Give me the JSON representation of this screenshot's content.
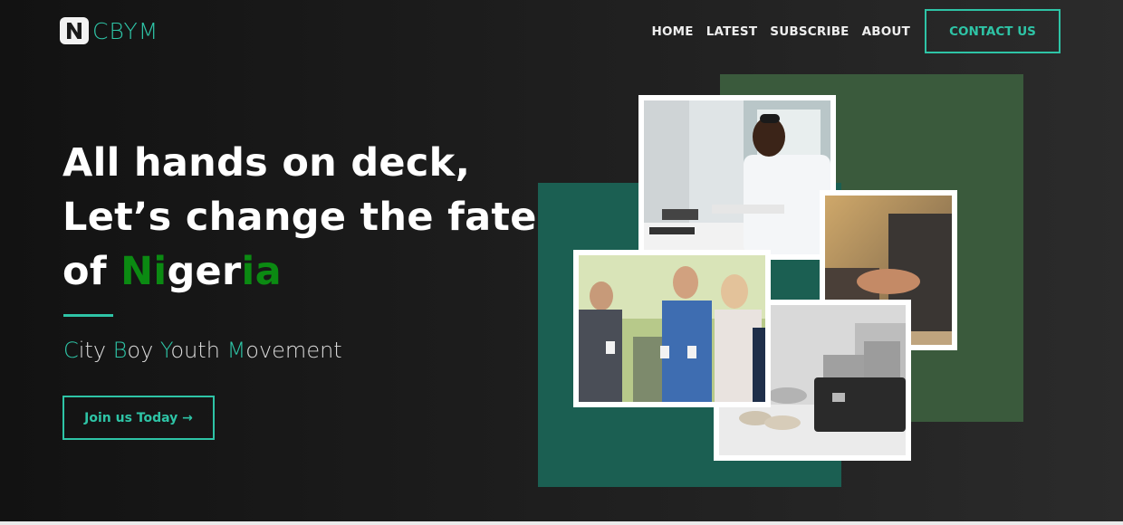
{
  "brand": {
    "logo_letter": "N",
    "name": "CBYM"
  },
  "nav": {
    "links": [
      "HOME",
      "LATEST",
      "SUBSCRIBE",
      "ABOUT"
    ],
    "contact_label": "CONTACT US"
  },
  "hero": {
    "title_line1": "All hands on deck,",
    "title_line2": "Let’s change the fate",
    "title_line3_prefix": "of ",
    "country_parts": [
      "Ni",
      "g",
      "er",
      "ia"
    ],
    "subtitle_parts": [
      "C",
      "ity ",
      "B",
      "oy ",
      "Y",
      "outh ",
      "M",
      "ovement"
    ],
    "join_label": "Join us Today →"
  },
  "colors": {
    "accent": "#2ec4a6",
    "green": "#0b8a12",
    "panel_dark_green": "#3a5a3c",
    "panel_teal": "#1b5f52"
  },
  "images": [
    {
      "name": "office-worker-photo"
    },
    {
      "name": "handshake-photo"
    },
    {
      "name": "coins-card-photo"
    },
    {
      "name": "people-talking-photo"
    }
  ]
}
